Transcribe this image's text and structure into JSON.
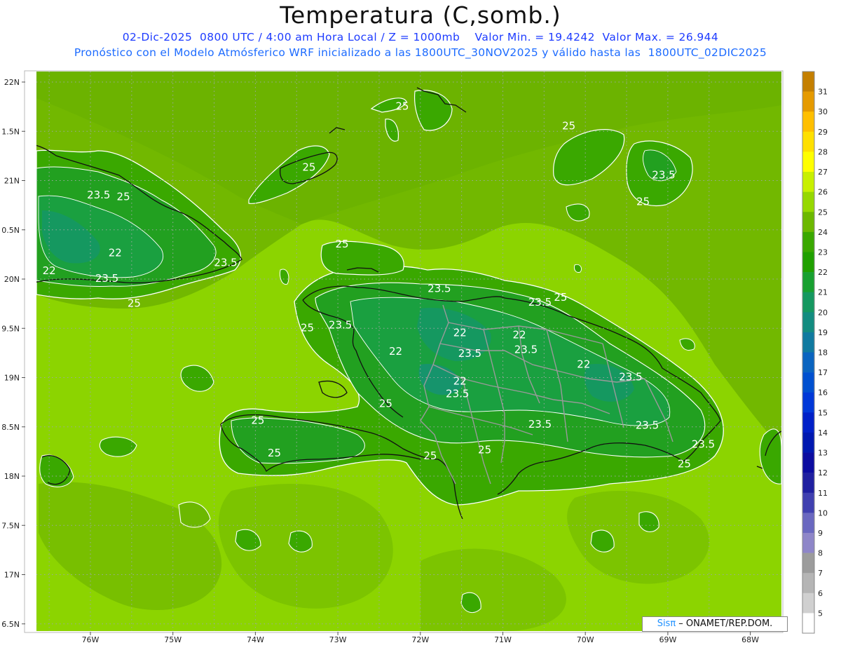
{
  "header": {
    "title": "Temperatura (C,somb.)",
    "line1": "02-Dic-2025  0800 UTC / 4:00 am Hora Local / Z = 1000mb    Valor Min. = 19.4242  Valor Max. = 26.944",
    "line2": "Pronóstico con el Modelo Atmósferico WRF inicializado a las 1800UTC_30NOV2025 y válido hasta las  1800UTC_02DIC2025"
  },
  "map": {
    "lat_labels": [
      "22N",
      "1.5N",
      "21N",
      "0.5N",
      "20N",
      "9.5N",
      "19N",
      "8.5N",
      "18N",
      "7.5N",
      "17N",
      "6.5N"
    ],
    "lon_labels": [
      "76W",
      "75W",
      "74W",
      "73W",
      "72W",
      "71W",
      "70W",
      "69W",
      "68W"
    ],
    "contour_labels": [
      {
        "text": "25",
        "lon": -72.22,
        "lat": 21.72
      },
      {
        "text": "25",
        "lon": -70.2,
        "lat": 21.52
      },
      {
        "text": "25",
        "lon": -73.35,
        "lat": 21.1
      },
      {
        "text": "23.5",
        "lon": -69.05,
        "lat": 21.02
      },
      {
        "text": "25",
        "lon": -69.3,
        "lat": 20.75
      },
      {
        "text": "23.5",
        "lon": -75.9,
        "lat": 20.82
      },
      {
        "text": "25",
        "lon": -75.6,
        "lat": 20.8
      },
      {
        "text": "25",
        "lon": -72.95,
        "lat": 20.32
      },
      {
        "text": "22",
        "lon": -75.7,
        "lat": 20.23
      },
      {
        "text": "23.5",
        "lon": -74.36,
        "lat": 20.13
      },
      {
        "text": "22",
        "lon": -76.5,
        "lat": 20.05
      },
      {
        "text": "23.5",
        "lon": -75.8,
        "lat": 19.97
      },
      {
        "text": "25",
        "lon": -75.47,
        "lat": 19.72
      },
      {
        "text": "23.5",
        "lon": -71.77,
        "lat": 19.87
      },
      {
        "text": "23.5",
        "lon": -70.55,
        "lat": 19.73
      },
      {
        "text": "25",
        "lon": -70.3,
        "lat": 19.78
      },
      {
        "text": "25",
        "lon": -73.37,
        "lat": 19.47
      },
      {
        "text": "23.5",
        "lon": -72.97,
        "lat": 19.5
      },
      {
        "text": "22",
        "lon": -71.52,
        "lat": 19.42
      },
      {
        "text": "22",
        "lon": -70.8,
        "lat": 19.4
      },
      {
        "text": "22",
        "lon": -72.3,
        "lat": 19.23
      },
      {
        "text": "23.5",
        "lon": -71.4,
        "lat": 19.21
      },
      {
        "text": "23.5",
        "lon": -70.72,
        "lat": 19.25
      },
      {
        "text": "22",
        "lon": -70.02,
        "lat": 19.1
      },
      {
        "text": "23.5",
        "lon": -69.45,
        "lat": 18.97
      },
      {
        "text": "22",
        "lon": -71.52,
        "lat": 18.93
      },
      {
        "text": "23.5",
        "lon": -71.55,
        "lat": 18.8
      },
      {
        "text": "25",
        "lon": -72.42,
        "lat": 18.7
      },
      {
        "text": "25",
        "lon": -73.97,
        "lat": 18.53
      },
      {
        "text": "23.5",
        "lon": -70.55,
        "lat": 18.49
      },
      {
        "text": "23.5",
        "lon": -69.25,
        "lat": 18.48
      },
      {
        "text": "23.5",
        "lon": -68.57,
        "lat": 18.29
      },
      {
        "text": "25",
        "lon": -71.22,
        "lat": 18.23
      },
      {
        "text": "25",
        "lon": -73.77,
        "lat": 18.2
      },
      {
        "text": "25",
        "lon": -71.88,
        "lat": 18.17
      },
      {
        "text": "25",
        "lon": -68.8,
        "lat": 18.09
      }
    ]
  },
  "colorbar": {
    "labels": [
      "31",
      "30",
      "29",
      "28",
      "27",
      "26",
      "25",
      "24",
      "23",
      "22",
      "21",
      "20",
      "19",
      "18",
      "17",
      "16",
      "15",
      "14",
      "13",
      "12",
      "11",
      "10",
      "9",
      "8",
      "7",
      "6",
      "5"
    ],
    "colors": [
      "#c47f00",
      "#e59a00",
      "#ffbf00",
      "#ffe000",
      "#ffff00",
      "#c8f000",
      "#96d800",
      "#6cb800",
      "#3aa800",
      "#20a000",
      "#18a030",
      "#159860",
      "#138c80",
      "#107aa0",
      "#0a64c0",
      "#0050d0",
      "#0038d8",
      "#0020c8",
      "#0018b0",
      "#0c0ca0",
      "#2020a0",
      "#4040b0",
      "#6a68c0",
      "#8e86c8",
      "#9c9c9c",
      "#b5b5b5",
      "#d0d0d0",
      "#ffffff"
    ]
  },
  "credit": {
    "brand": "Sisπ",
    "text": " – ONAMET/REP.DOM."
  }
}
